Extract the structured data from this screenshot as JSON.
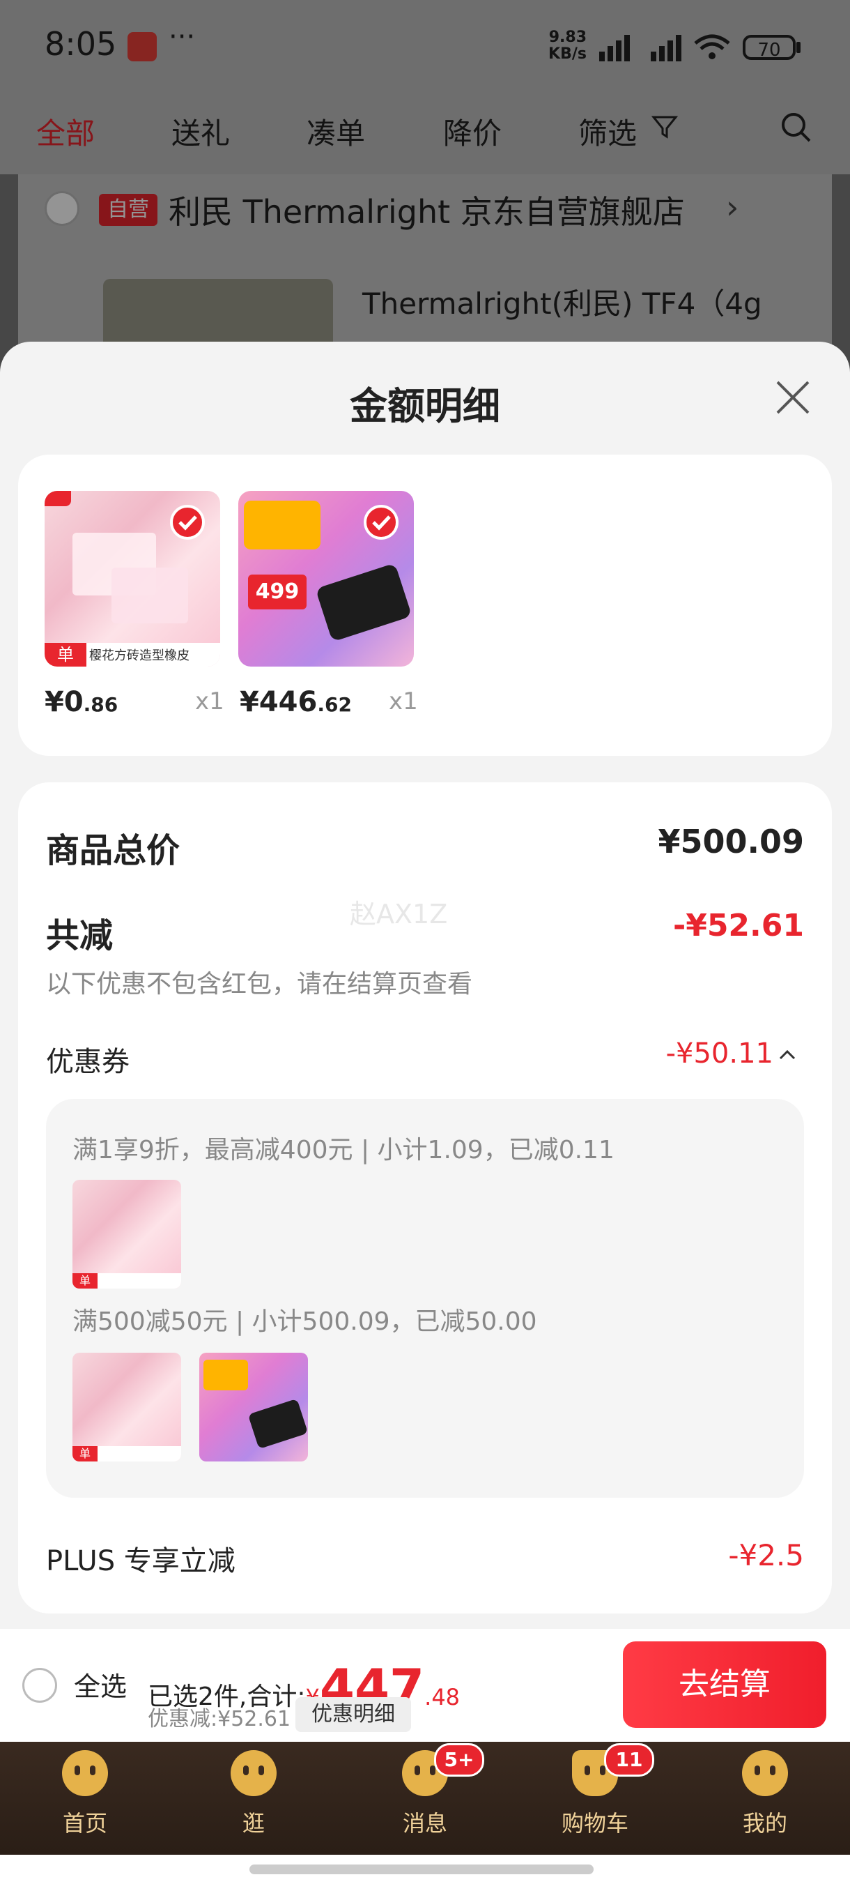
{
  "status_bar": {
    "time": "8:05",
    "more": "···",
    "net_speed_value": "9.83",
    "net_speed_unit": "KB/s",
    "battery": "70"
  },
  "top_tabs": [
    "全部",
    "送礼",
    "凑单",
    "降价",
    "筛选"
  ],
  "store": {
    "badge": "自营",
    "name": "利民 Thermalright 京东自营旗舰店",
    "chevron": "›",
    "product_title": "Thermalright(利民) TF4（4g"
  },
  "sheet": {
    "title": "金额明细",
    "items": [
      {
        "price_int": "¥0",
        "price_dec": ".86",
        "qty": "x1",
        "image": "eraser",
        "image_caption": "樱花方砖造型橡皮"
      },
      {
        "price_int": "¥446",
        "price_dec": ".62",
        "qty": "x1",
        "image": "kingston-ssd",
        "image_caption": "499"
      }
    ],
    "total_label": "商品总价",
    "total_value": "¥500.09",
    "reduce_label": "共减",
    "reduce_value": "-¥52.61",
    "reduce_note": "以下优惠不包含红包，请在结算页查看",
    "watermark": "赵AX1Z",
    "coupon_label": "优惠券",
    "coupon_value": "-¥50.11",
    "coupon_lines": [
      "满1享9折，最高减400元 | 小计1.09，已减0.11",
      "满500减50元 | 小计500.09，已减50.00"
    ],
    "plus_label": "PLUS 专享立减",
    "plus_value": "-¥2.5"
  },
  "bottom_bar": {
    "select_all": "全选",
    "selected_text": "已选2件,合计:",
    "yen": "¥",
    "total_int": "447",
    "total_dec": ".48",
    "discount_text": "优惠减:¥52.61",
    "detail_chip": "优惠明细",
    "checkout": "去结算"
  },
  "nav": [
    {
      "label": "首页",
      "badge": ""
    },
    {
      "label": "逛",
      "badge": ""
    },
    {
      "label": "消息",
      "badge": "5+"
    },
    {
      "label": "购物车",
      "badge": "11"
    },
    {
      "label": "我的",
      "badge": ""
    }
  ],
  "colors": {
    "accent_red": "#e8252e",
    "nav_gold": "#e5b24a",
    "nav_bg": "#2a1e16"
  }
}
